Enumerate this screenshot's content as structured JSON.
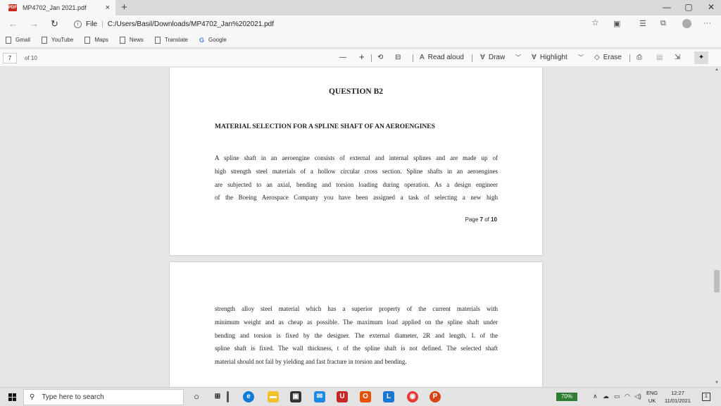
{
  "browser": {
    "tab_title": "MP4702_Jan 2021.pdf",
    "tab_close": "×",
    "new_tab": "+",
    "pdf_badge": "PDF",
    "window_controls": {
      "minimize": "—",
      "maximize": "▢",
      "close": "✕"
    }
  },
  "address_bar": {
    "scheme_label": "File",
    "url": "C:/Users/Basil/Downloads/MP4702_Jan%202021.pdf",
    "icons": [
      "back-icon",
      "forward-icon",
      "refresh-icon",
      "info-icon",
      "favorite-star-icon",
      "collections-icon",
      "favorites-icon",
      "extensions-icon",
      "profile-icon",
      "more-icon"
    ]
  },
  "bookmarks": [
    {
      "label": "Gmail",
      "icon": "page-icon"
    },
    {
      "label": "YouTube",
      "icon": "page-icon"
    },
    {
      "label": "Maps",
      "icon": "page-icon"
    },
    {
      "label": "News",
      "icon": "page-icon"
    },
    {
      "label": "Translate",
      "icon": "page-icon"
    },
    {
      "label": "Google",
      "icon": "google-icon"
    }
  ],
  "pdf_toolbar": {
    "current_page": "7",
    "page_count": "of 10",
    "zoom_out": "—",
    "zoom_in": "+",
    "read_aloud": "Read aloud",
    "draw": "Draw",
    "highlight": "Highlight",
    "erase": "Erase"
  },
  "document": {
    "page1": {
      "question": "QUESTION B2",
      "subtitle": "MATERIAL SELECTION FOR A SPLINE SHAFT OF AN AEROENGINES",
      "lines": [
        "A spline shaft in an aeroengine consists of external and internal splines and are made up of",
        "high strength steel materials of a hollow circular cross section. Spline shafts in an aeroengines",
        "are subjected to an axial, bending and torsion loading during operation. As a design engineer",
        "of the Boeing Aerospace Company you have been assigned a task of selecting a new high"
      ],
      "page_label": "Page",
      "page_num": "7",
      "page_of": "of",
      "page_total": "10"
    },
    "page2": {
      "lines": [
        "strength alloy steel material which has a superior property of the current materials with",
        "minimum weight and as cheap as possible. The maximum load applied on the spline shaft under",
        "bending and torsion is fixed by the designer. The external diameter, 2R and length, L of the",
        "spline shaft is fixed. The wall thickness, t of the spline shaft is not defined. The selected shaft",
        "material should not fail by yielding and fast fracture in torsion and bending."
      ]
    }
  },
  "taskbar": {
    "search_placeholder": "Type here to search",
    "battery": "70%",
    "language": "ENG",
    "region": "UK",
    "time": "12:27",
    "date": "11/01/2021"
  }
}
